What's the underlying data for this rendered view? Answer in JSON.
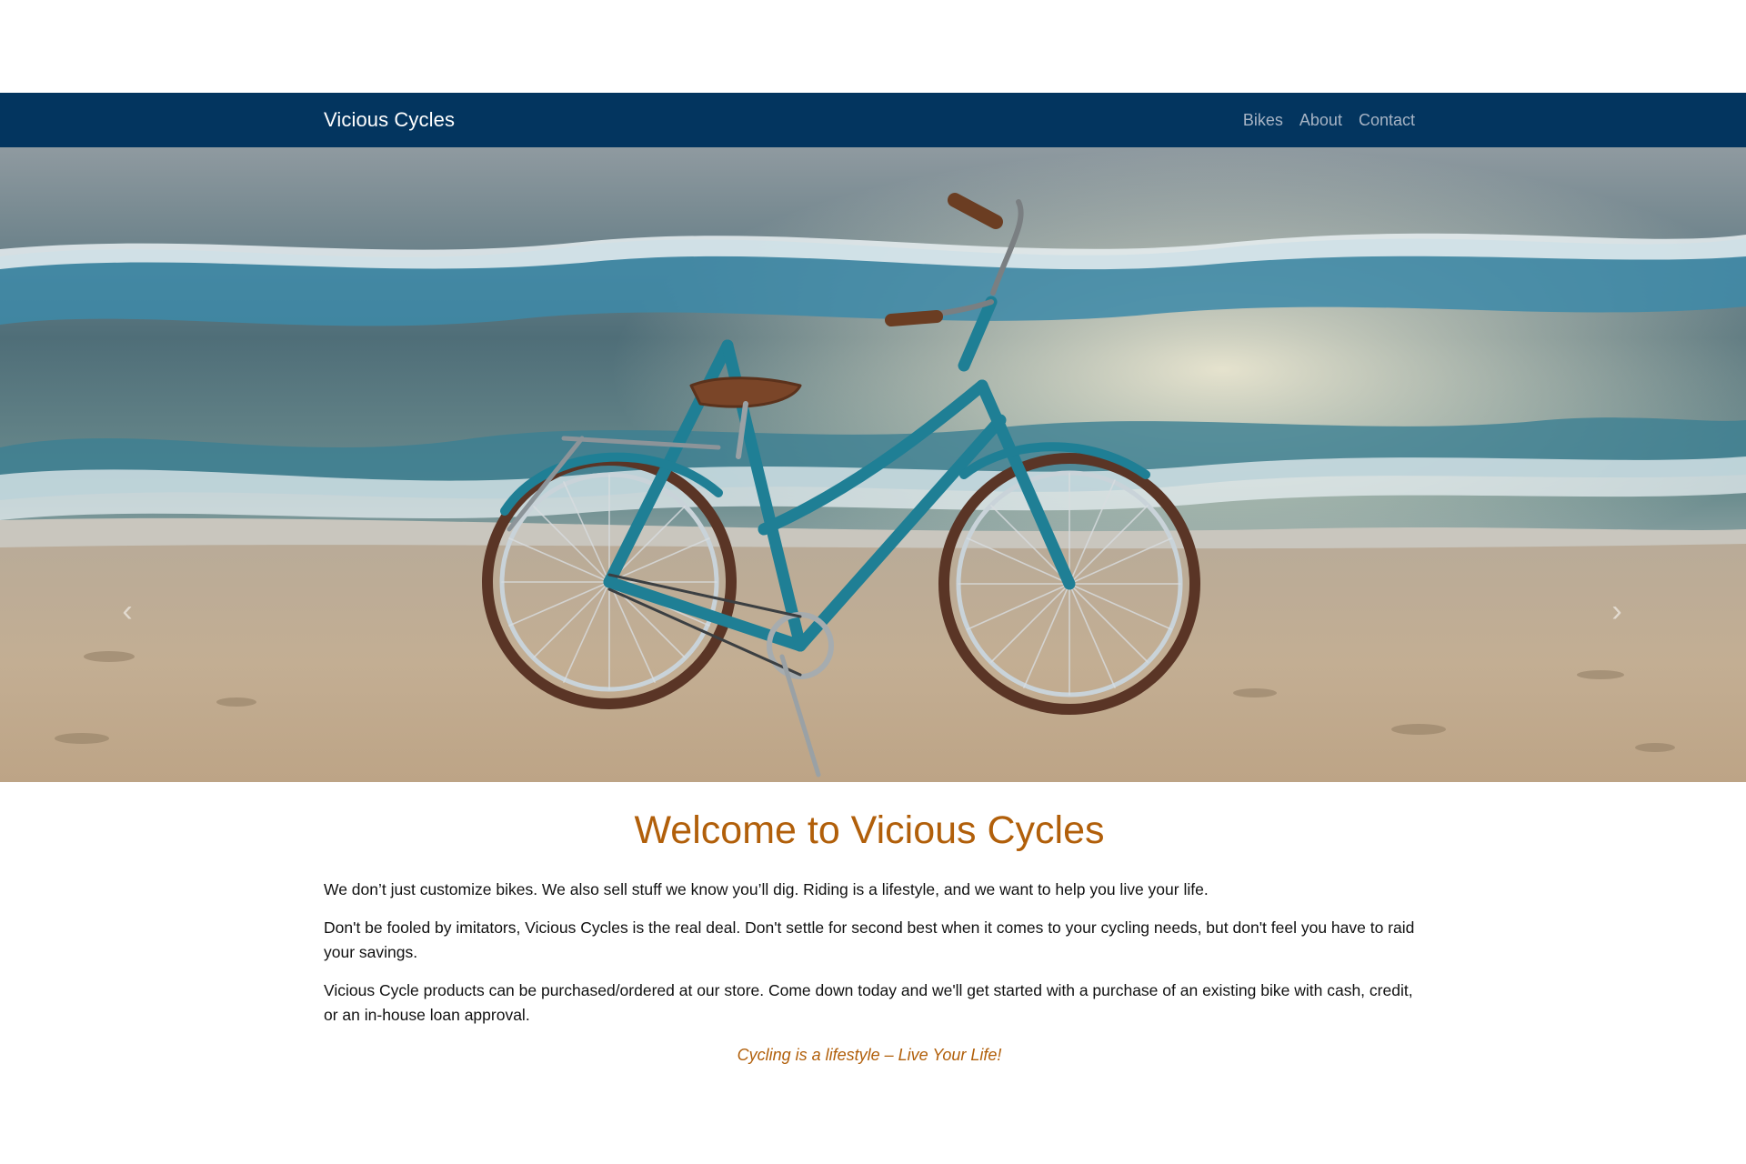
{
  "navbar": {
    "brand": "Vicious Cycles",
    "links": [
      "Bikes",
      "About",
      "Contact"
    ]
  },
  "hero": {
    "image": "bicycle-on-beach-photo",
    "prev_icon": "chevron-left-icon",
    "next_icon": "chevron-right-icon"
  },
  "main": {
    "heading": "Welcome to Vicious Cycles",
    "paragraphs": [
      "We don’t just customize bikes. We also sell stuff we know you’ll dig. Riding is a lifestyle, and we want to help you live your life.",
      "Don't be fooled by imitators, Vicious Cycles is the real deal. Don't settle for second best when it comes to your cycling needs, but don't feel you have to raid your savings.",
      "Vicious Cycle products can be purchased/ordered at our store. Come down today and we'll get started with a purchase of an existing bike with cash, credit, or an in-house loan approval."
    ],
    "tagline": "Cycling is a lifestyle – Live Your Life!"
  },
  "colors": {
    "navbar_bg": "#03355f",
    "accent": "#b15f0a",
    "bike": "#1f7f95"
  }
}
